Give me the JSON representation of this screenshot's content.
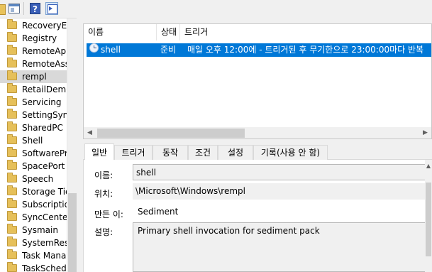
{
  "toolbar": {
    "icons": [
      "folder-icon",
      "show-hide-console-tree-icon",
      "help-icon",
      "show-hide-action-pane-icon"
    ]
  },
  "tree": {
    "items": [
      {
        "label": "RecoveryEn",
        "selected": false
      },
      {
        "label": "Registry",
        "selected": false
      },
      {
        "label": "RemoteApp",
        "selected": false
      },
      {
        "label": "RemoteAss",
        "selected": false
      },
      {
        "label": "rempl",
        "selected": true
      },
      {
        "label": "RetailDemc",
        "selected": false
      },
      {
        "label": "Servicing",
        "selected": false
      },
      {
        "label": "SettingSync",
        "selected": false
      },
      {
        "label": "SharedPC",
        "selected": false
      },
      {
        "label": "Shell",
        "selected": false
      },
      {
        "label": "SoftwarePro",
        "selected": false
      },
      {
        "label": "SpacePort",
        "selected": false
      },
      {
        "label": "Speech",
        "selected": false
      },
      {
        "label": "Storage Tie",
        "selected": false
      },
      {
        "label": "Subscriptio",
        "selected": false
      },
      {
        "label": "SyncCenter",
        "selected": false
      },
      {
        "label": "Sysmain",
        "selected": false
      },
      {
        "label": "SystemRest",
        "selected": false
      },
      {
        "label": "Task Manag",
        "selected": false
      },
      {
        "label": "TaskSchedu",
        "selected": false
      }
    ]
  },
  "tasklist": {
    "columns": {
      "name": "이름",
      "status": "상태",
      "triggers": "트리거"
    },
    "row": {
      "name": "shell",
      "status": "준비",
      "trigger": "매일 오후 12:00에 - 트리거된 후 무기한으로 23:00:00마다 반복"
    }
  },
  "tabs": [
    "일반",
    "트리거",
    "동작",
    "조건",
    "설정",
    "기록(사용 안 함)"
  ],
  "general": {
    "name_label": "이름:",
    "name_value": "shell",
    "location_label": "위치:",
    "location_value": "\\Microsoft\\Windows\\rempl",
    "author_label": "만든 이:",
    "author_value": "Sediment",
    "description_label": "설명:",
    "description_value": "Primary shell invocation for sediment pack"
  },
  "colors": {
    "selection": "#0078d7",
    "tree_selection": "#d9d9d9",
    "window_bg": "#f0f0f0"
  }
}
